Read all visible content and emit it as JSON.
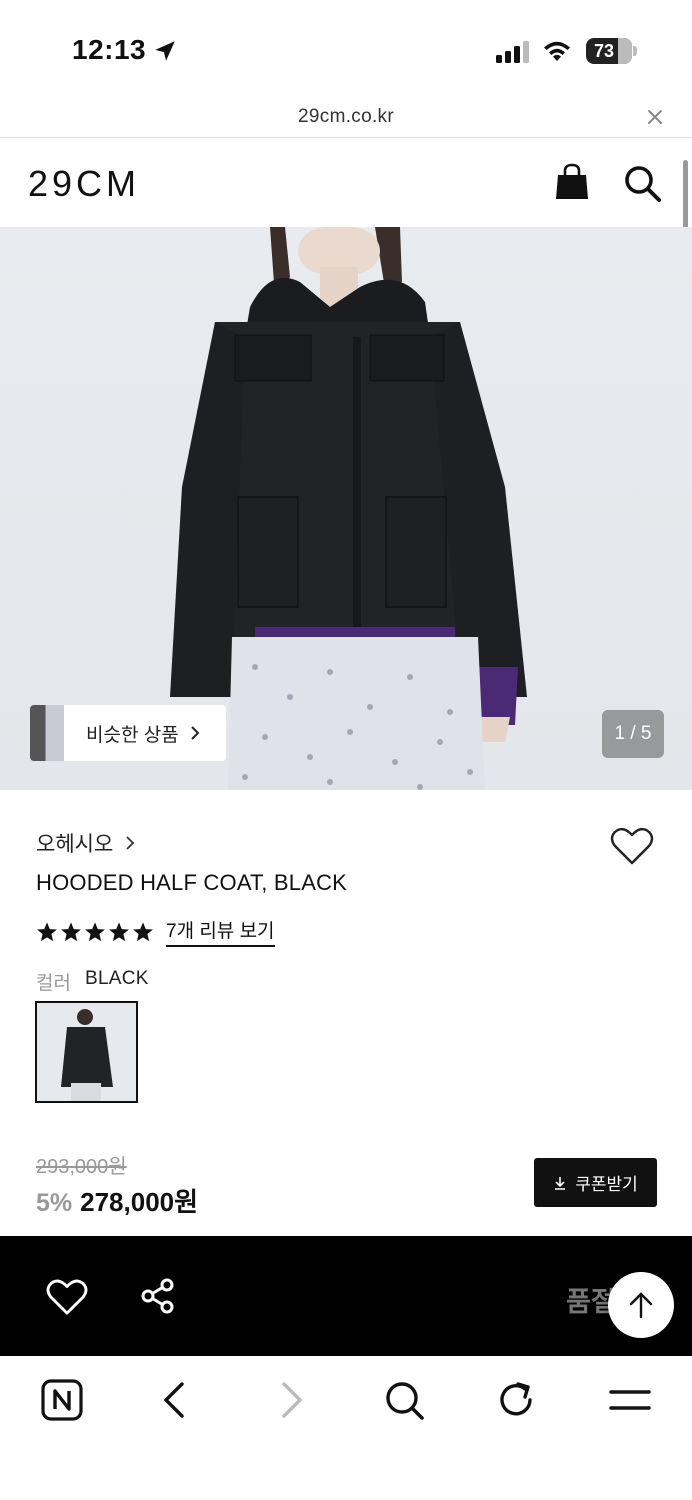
{
  "status_bar": {
    "time": "12:13",
    "battery": "73",
    "battery_level": 0.73
  },
  "browser": {
    "url": "29cm.co.kr"
  },
  "header": {
    "logo": "29CM"
  },
  "gallery": {
    "similar_label": "비슷한 상품",
    "counter": "1 / 5"
  },
  "product": {
    "brand": "오헤시오",
    "name": "HOODED HALF COAT, BLACK",
    "rating_stars": 5,
    "review_link": "7개 리뷰 보기",
    "color_label": "컬러",
    "color_value": "BLACK",
    "original_price": "293,000원",
    "discount": "5%",
    "price": "278,000원",
    "coupon_label": "쿠폰받기"
  },
  "action_bar": {
    "soldout_label": "품절"
  },
  "colors": {
    "accent": "#111111",
    "muted": "#999999",
    "bar": "#000000"
  }
}
